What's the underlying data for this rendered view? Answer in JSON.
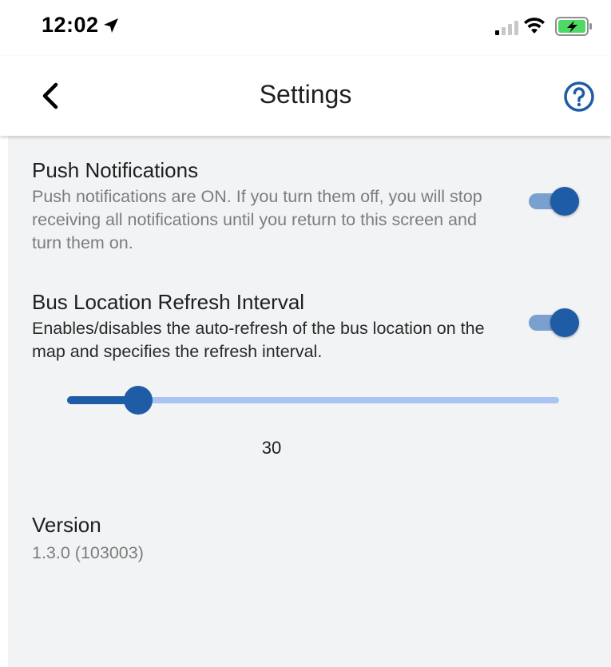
{
  "status_bar": {
    "time": "12:02",
    "icons": [
      "location-arrow-icon",
      "cellular-signal-icon",
      "wifi-icon",
      "battery-charging-icon"
    ],
    "battery_color": "#4cd964"
  },
  "header": {
    "title": "Settings",
    "back_icon": "chevron-left-icon",
    "help_icon": "help-circle-icon",
    "accent_color": "#1e5ca6"
  },
  "settings": {
    "push_notifications": {
      "title": "Push Notifications",
      "description": "Push notifications are ON. If you turn them off, you will stop receiving all notifications until you return to this screen and turn them on.",
      "enabled": true
    },
    "bus_refresh": {
      "title": "Bus Location Refresh Interval",
      "description": "Enables/disables the auto-refresh of the bus location on the map and specifies the refresh interval.",
      "enabled": true,
      "slider_fraction": 0.145,
      "value": "30"
    },
    "version": {
      "title": "Version",
      "value": "1.3.0 (103003)"
    }
  },
  "colors": {
    "toggle_track": "#7aa0cf",
    "toggle_thumb": "#1e5ca6",
    "slider_track": "#a9c4f0",
    "background": "#f2f3f4"
  }
}
